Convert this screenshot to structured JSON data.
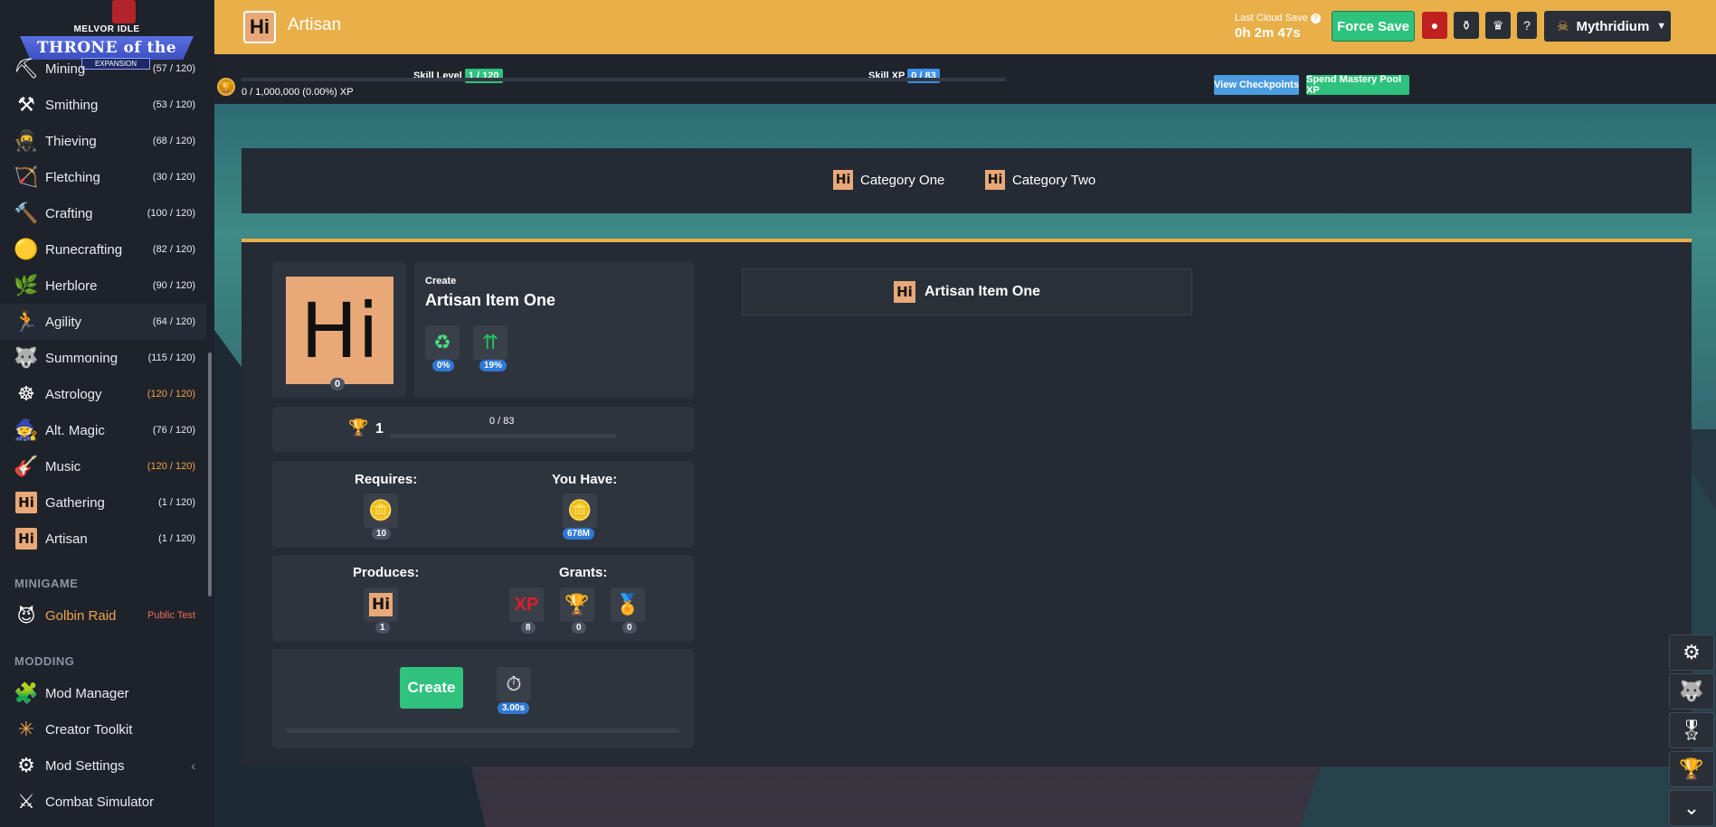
{
  "header": {
    "title": "Artisan",
    "title_icon": "Hi",
    "cloud_label": "Last Cloud Save",
    "cloud_time": "0h 2m 47s",
    "force_save": "Force Save",
    "help": "?",
    "user": "Mythridium",
    "accent": "#e9b04a"
  },
  "logo": {
    "brand": "MELVOR IDLE",
    "title": "THRONE of the HERALD",
    "expansion": "EXPANSION"
  },
  "sidebar": {
    "skills": [
      {
        "name": "Mining",
        "level": "(57 / 120)",
        "icon": "pickaxe-icon",
        "glyph": "⛏"
      },
      {
        "name": "Smithing",
        "level": "(53 / 120)",
        "icon": "anvil-icon",
        "glyph": "⚒"
      },
      {
        "name": "Thieving",
        "level": "(68 / 120)",
        "icon": "thief-icon",
        "glyph": "🥷"
      },
      {
        "name": "Fletching",
        "level": "(30 / 120)",
        "icon": "bow-icon",
        "glyph": "🏹"
      },
      {
        "name": "Crafting",
        "level": "(100 / 120)",
        "icon": "hammer-icon",
        "glyph": "🔨"
      },
      {
        "name": "Runecrafting",
        "level": "(82 / 120)",
        "icon": "rune-icon",
        "glyph": "🟡"
      },
      {
        "name": "Herblore",
        "level": "(90 / 120)",
        "icon": "herb-icon",
        "glyph": "🌿"
      },
      {
        "name": "Agility",
        "level": "(64 / 120)",
        "icon": "runner-icon",
        "glyph": "🏃"
      },
      {
        "name": "Summoning",
        "level": "(115 / 120)",
        "icon": "wolf-icon",
        "glyph": "🐺"
      },
      {
        "name": "Astrology",
        "level": "(120 / 120)",
        "icon": "star-wheel-icon",
        "glyph": "☸"
      },
      {
        "name": "Alt. Magic",
        "level": "(76 / 120)",
        "icon": "wizard-hat-icon",
        "glyph": "🧙"
      },
      {
        "name": "Music",
        "level": "(120 / 120)",
        "icon": "guitar-icon",
        "glyph": "🎸"
      },
      {
        "name": "Gathering",
        "level": "(1 / 120)",
        "icon": "hi-icon",
        "glyph": "Hi"
      },
      {
        "name": "Artisan",
        "level": "(1 / 120)",
        "icon": "hi-icon",
        "glyph": "Hi"
      }
    ],
    "minigame_header": "MINIGAME",
    "golbin": {
      "name": "Golbin Raid",
      "badge": "Public Test"
    },
    "modding_header": "MODDING",
    "modding": [
      {
        "name": "Mod Manager",
        "glyph": "🧩"
      },
      {
        "name": "Creator Toolkit",
        "glyph": "✳"
      },
      {
        "name": "Mod Settings",
        "glyph": "⚙"
      },
      {
        "name": "Combat Simulator",
        "glyph": "⚔"
      }
    ],
    "collapse": "‹"
  },
  "progress": {
    "skill_level_label": "Skill Level",
    "skill_level_value": "1 / 120",
    "skill_xp_label": "Skill XP",
    "skill_xp_value": "0 / 83",
    "mastery_text": "0 / 1,000,000 (0.00%) XP",
    "view_checkpoints": "View Checkpoints",
    "spend_mastery": "Spend Mastery Pool XP"
  },
  "categories": [
    {
      "label": "Category One",
      "icon": "Hi"
    },
    {
      "label": "Category Two",
      "icon": "Hi"
    }
  ],
  "recipe": {
    "icon": "Hi",
    "count": "0",
    "create_label": "Create",
    "name": "Artisan Item One",
    "preserve_pct": "0%",
    "double_pct": "19%",
    "mastery_level": "1",
    "mastery_progress": "0 / 83",
    "requires_label": "Requires:",
    "requires_qty": "10",
    "have_label": "You Have:",
    "have_qty": "678M",
    "produces_label": "Produces:",
    "produces_qty": "1",
    "grants_label": "Grants:",
    "grant_xp_glyph": "XP",
    "grant_xp": "8",
    "grant_mastery": "0",
    "grant_pool": "0",
    "button": "Create",
    "time": "3.00s"
  },
  "recipe_tab": {
    "icon": "Hi",
    "label": "Artisan Item One"
  }
}
